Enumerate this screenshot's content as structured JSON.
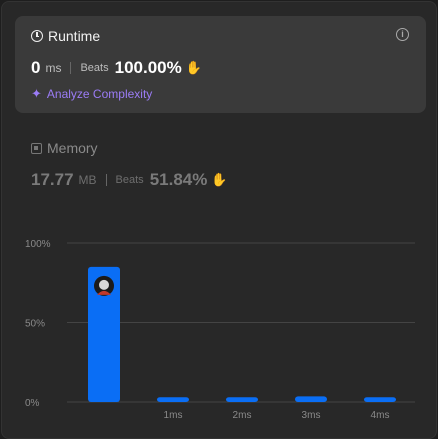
{
  "runtime": {
    "title": "Runtime",
    "value": "0",
    "unit": "ms",
    "beats_label": "Beats",
    "beats_pct": "100.00%",
    "analyze_label": "Analyze Complexity"
  },
  "memory": {
    "title": "Memory",
    "value": "17.77",
    "unit": "MB",
    "beats_label": "Beats",
    "beats_pct": "51.84%"
  },
  "icons": {
    "runtime": "clock-icon",
    "info": "info-icon",
    "beats": "clap-icon",
    "analyze": "sparkle-icon",
    "memory": "chip-icon",
    "avatar": "avatar"
  },
  "colors": {
    "bar": "#0a6ef5",
    "accent": "#9b7cf6",
    "beats": "#2fbf4a"
  },
  "chart_data": {
    "type": "bar",
    "categories": [
      "",
      "1ms",
      "2ms",
      "3ms",
      "4ms"
    ],
    "values": [
      85,
      3,
      3,
      3.5,
      3
    ],
    "y_ticks": [
      "0%",
      "50%",
      "100%"
    ],
    "ylim": [
      0,
      100
    ],
    "grid": true,
    "highlighted_index": 0
  }
}
